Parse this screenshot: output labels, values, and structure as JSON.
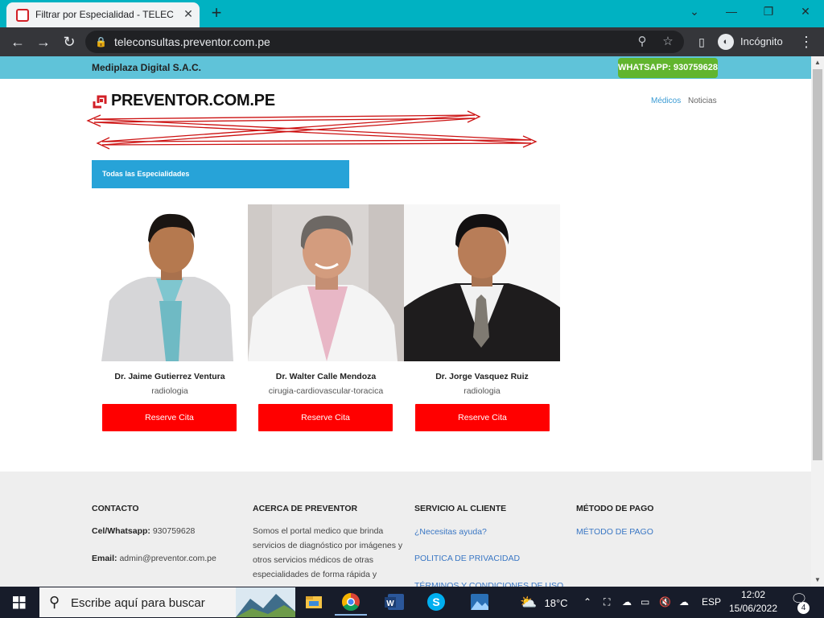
{
  "browser": {
    "tab_title": "Filtrar por Especialidad - TELECON",
    "url": "teleconsultas.preventor.com.pe",
    "incognito_label": "Incógnito"
  },
  "site": {
    "company": "Mediplaza Digital S.A.C.",
    "whatsapp": "WHATSAPP: 930759628",
    "logo_text": "PREVENTOR.COM.PE",
    "nav": [
      "Médicos",
      "Noticias"
    ],
    "specialty_filter": "Todas las Especialidades",
    "doctors": [
      {
        "name": "Dr. Jaime Gutierrez Ventura",
        "specialty": "radiologia",
        "button": "Reserve Cita"
      },
      {
        "name": "Dr. Walter Calle Mendoza",
        "specialty": "cirugia-cardiovascular-toracica",
        "button": "Reserve Cita"
      },
      {
        "name": "Dr. Jorge Vasquez Ruiz",
        "specialty": "radiologia",
        "button": "Reserve Cita"
      }
    ]
  },
  "footer": {
    "contact": {
      "heading": "CONTACTO",
      "phone_label": "Cel/Whatsapp:",
      "phone": "930759628",
      "email_label": "Email:",
      "email": "admin@preventor.com.pe"
    },
    "about": {
      "heading": "ACERCA DE PREVENTOR",
      "lines": [
        "Somos el portal medico que brinda",
        "servicios de diagnóstico por imágenes y",
        "otros servicios médicos de otras",
        "especialidades de forma rápida y"
      ]
    },
    "service": {
      "heading": "SERVICIO AL CLIENTE",
      "links": [
        "¿Necesitas ayuda?",
        "POLITICA DE PRIVACIDAD",
        "TÉRMINOS Y CONDICIONES DE USO"
      ]
    },
    "payment": {
      "heading": "MÉTODO DE PAGO",
      "link": "MÉTODO DE PAGO"
    }
  },
  "taskbar": {
    "search_placeholder": "Escribe aquí para buscar",
    "temperature": "18°C",
    "language": "ESP",
    "time": "12:02",
    "date": "15/06/2022",
    "notification_count": "4"
  },
  "colors": {
    "tab_bar": "#00b2c2",
    "top_bar": "#5fc3d9",
    "whatsapp": "#61b52e",
    "specialty_bar": "#27a3d8",
    "reserve_button": "#ff0000",
    "nav_active": "#3a9bd4",
    "footer_link": "#3a77c4"
  }
}
